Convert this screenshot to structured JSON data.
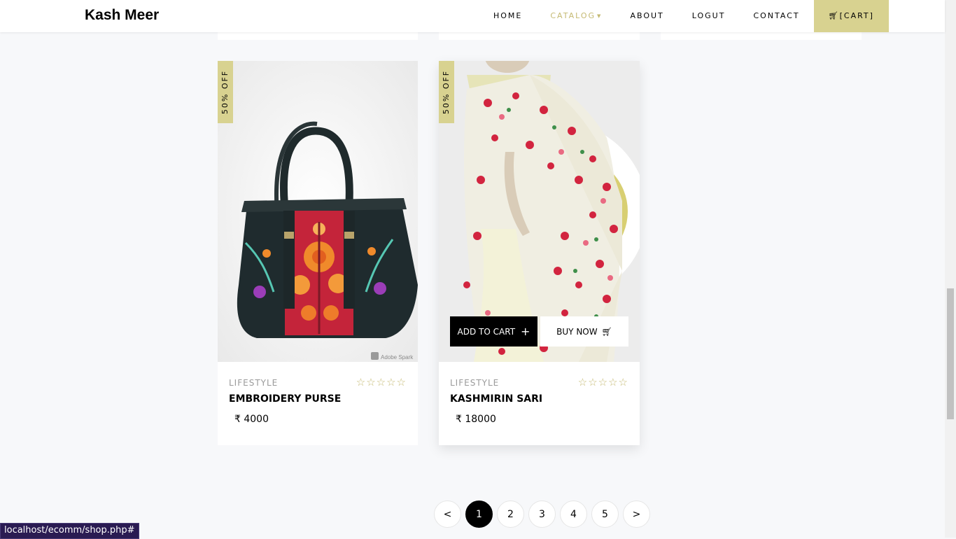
{
  "brand": "Kash Meer",
  "nav": {
    "items": [
      {
        "label": "HOME",
        "active": false
      },
      {
        "label": "CATALOG",
        "active": true,
        "has_dropdown": true
      },
      {
        "label": "ABOUT",
        "active": false
      },
      {
        "label": "LOGUT",
        "active": false
      },
      {
        "label": "CONTACT",
        "active": false
      }
    ],
    "cart_label": "[CART]",
    "cart_icon": "cart-icon"
  },
  "products": [
    {
      "badge": "50% OFF",
      "category": "LIFESTYLE",
      "name": "EMBROIDERY PURSE",
      "price": "₹ 4000",
      "rating": 0,
      "max_rating": 5,
      "image_watermark": "Adobe Spark"
    },
    {
      "badge": "50% OFF",
      "category": "LIFESTYLE",
      "name": "KASHMIRIN SARI",
      "price": "₹ 18000",
      "rating": 0,
      "max_rating": 5,
      "add_to_cart_label": "ADD TO CART",
      "buy_now_label": "BUY NOW"
    }
  ],
  "pagination": {
    "prev": "<",
    "pages": [
      "1",
      "2",
      "3",
      "4",
      "5"
    ],
    "current": "1",
    "next": ">"
  },
  "status_url": "localhost/ecomm/shop.php#",
  "colors": {
    "accent": "#d8d290",
    "accent_text": "#c5ba73",
    "background": "#f7f8fa",
    "status_bar": "#2a1b52"
  }
}
